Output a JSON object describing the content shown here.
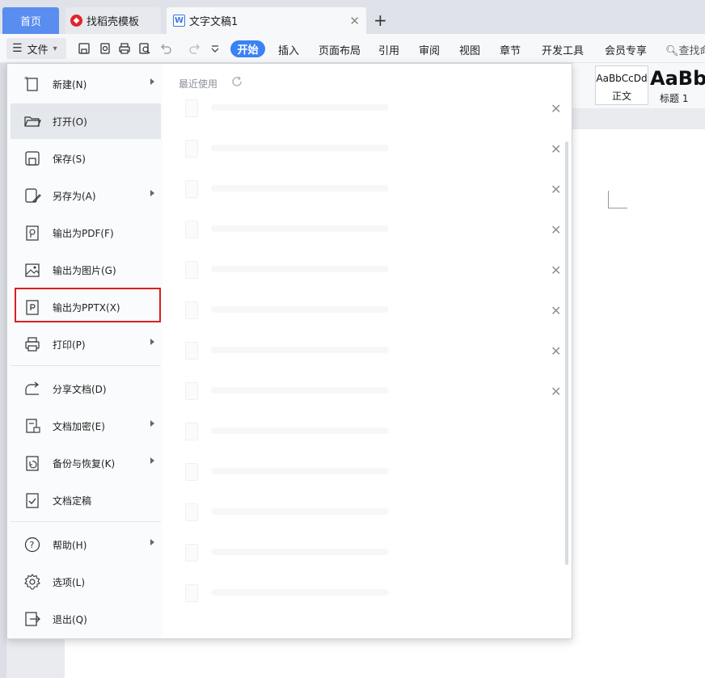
{
  "tabs": {
    "home": "首页",
    "template": "找稻壳模板",
    "document": "文字文稿1"
  },
  "ribbon": {
    "file_label": "文件",
    "tabs": [
      "开始",
      "插入",
      "页面布局",
      "引用",
      "审阅",
      "视图",
      "章节",
      "开发工具",
      "会员专享"
    ],
    "search": "查找命"
  },
  "styles": {
    "normal_sample": "AaBbCcDd",
    "normal_caption": "正文",
    "heading_sample": "AaBbA",
    "heading_caption": "标题 1"
  },
  "file_menu": {
    "items": [
      {
        "label": "新建(N)",
        "icon": "new-icon",
        "submenu": true
      },
      {
        "label": "打开(O)",
        "icon": "folder-icon",
        "submenu": false
      },
      {
        "label": "保存(S)",
        "icon": "save-icon",
        "submenu": false
      },
      {
        "label": "另存为(A)",
        "icon": "save-as-icon",
        "submenu": true
      },
      {
        "label": "输出为PDF(F)",
        "icon": "pdf-icon",
        "submenu": false
      },
      {
        "label": "输出为图片(G)",
        "icon": "image-icon",
        "submenu": false
      },
      {
        "label": "输出为PPTX(X)",
        "icon": "pptx-icon",
        "submenu": false
      },
      {
        "label": "打印(P)",
        "icon": "print-icon",
        "submenu": true
      },
      {
        "label": "分享文档(D)",
        "icon": "share-icon",
        "submenu": false
      },
      {
        "label": "文档加密(E)",
        "icon": "encrypt-icon",
        "submenu": true
      },
      {
        "label": "备份与恢复(K)",
        "icon": "backup-icon",
        "submenu": true
      },
      {
        "label": "文档定稿",
        "icon": "finalize-icon",
        "submenu": false
      },
      {
        "label": "帮助(H)",
        "icon": "help-icon",
        "submenu": true
      },
      {
        "label": "选项(L)",
        "icon": "settings-icon",
        "submenu": false
      },
      {
        "label": "退出(Q)",
        "icon": "exit-icon",
        "submenu": false
      }
    ]
  },
  "recent": {
    "title": "最近使用"
  },
  "colors": {
    "accent": "#3a82f6",
    "highlight": "#d9201f",
    "home_tab": "#5a8df0"
  }
}
